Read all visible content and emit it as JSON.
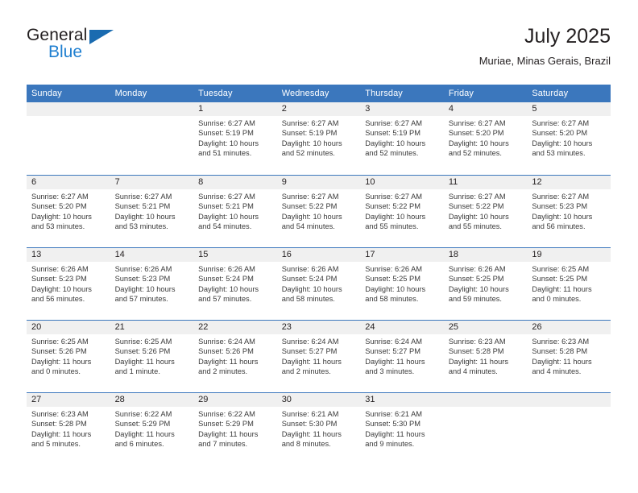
{
  "brand": {
    "name_top": "General",
    "name_bottom": "Blue",
    "accent_dark": "#1a6bb0",
    "accent_blue": "#1f7fd0"
  },
  "header": {
    "title": "July 2025",
    "subtitle": "Muriae, Minas Gerais, Brazil"
  },
  "calendar": {
    "header_color": "#3b77bd",
    "weekday_headers": [
      "Sunday",
      "Monday",
      "Tuesday",
      "Wednesday",
      "Thursday",
      "Friday",
      "Saturday"
    ],
    "weeks": [
      [
        {
          "day": "",
          "sunrise": "",
          "sunset": "",
          "daylight": "",
          "empty": true
        },
        {
          "day": "",
          "sunrise": "",
          "sunset": "",
          "daylight": "",
          "empty": true
        },
        {
          "day": "1",
          "sunrise": "Sunrise: 6:27 AM",
          "sunset": "Sunset: 5:19 PM",
          "daylight": "Daylight: 10 hours and 51 minutes."
        },
        {
          "day": "2",
          "sunrise": "Sunrise: 6:27 AM",
          "sunset": "Sunset: 5:19 PM",
          "daylight": "Daylight: 10 hours and 52 minutes."
        },
        {
          "day": "3",
          "sunrise": "Sunrise: 6:27 AM",
          "sunset": "Sunset: 5:19 PM",
          "daylight": "Daylight: 10 hours and 52 minutes."
        },
        {
          "day": "4",
          "sunrise": "Sunrise: 6:27 AM",
          "sunset": "Sunset: 5:20 PM",
          "daylight": "Daylight: 10 hours and 52 minutes."
        },
        {
          "day": "5",
          "sunrise": "Sunrise: 6:27 AM",
          "sunset": "Sunset: 5:20 PM",
          "daylight": "Daylight: 10 hours and 53 minutes."
        }
      ],
      [
        {
          "day": "6",
          "sunrise": "Sunrise: 6:27 AM",
          "sunset": "Sunset: 5:20 PM",
          "daylight": "Daylight: 10 hours and 53 minutes."
        },
        {
          "day": "7",
          "sunrise": "Sunrise: 6:27 AM",
          "sunset": "Sunset: 5:21 PM",
          "daylight": "Daylight: 10 hours and 53 minutes."
        },
        {
          "day": "8",
          "sunrise": "Sunrise: 6:27 AM",
          "sunset": "Sunset: 5:21 PM",
          "daylight": "Daylight: 10 hours and 54 minutes."
        },
        {
          "day": "9",
          "sunrise": "Sunrise: 6:27 AM",
          "sunset": "Sunset: 5:22 PM",
          "daylight": "Daylight: 10 hours and 54 minutes."
        },
        {
          "day": "10",
          "sunrise": "Sunrise: 6:27 AM",
          "sunset": "Sunset: 5:22 PM",
          "daylight": "Daylight: 10 hours and 55 minutes."
        },
        {
          "day": "11",
          "sunrise": "Sunrise: 6:27 AM",
          "sunset": "Sunset: 5:22 PM",
          "daylight": "Daylight: 10 hours and 55 minutes."
        },
        {
          "day": "12",
          "sunrise": "Sunrise: 6:27 AM",
          "sunset": "Sunset: 5:23 PM",
          "daylight": "Daylight: 10 hours and 56 minutes."
        }
      ],
      [
        {
          "day": "13",
          "sunrise": "Sunrise: 6:26 AM",
          "sunset": "Sunset: 5:23 PM",
          "daylight": "Daylight: 10 hours and 56 minutes."
        },
        {
          "day": "14",
          "sunrise": "Sunrise: 6:26 AM",
          "sunset": "Sunset: 5:23 PM",
          "daylight": "Daylight: 10 hours and 57 minutes."
        },
        {
          "day": "15",
          "sunrise": "Sunrise: 6:26 AM",
          "sunset": "Sunset: 5:24 PM",
          "daylight": "Daylight: 10 hours and 57 minutes."
        },
        {
          "day": "16",
          "sunrise": "Sunrise: 6:26 AM",
          "sunset": "Sunset: 5:24 PM",
          "daylight": "Daylight: 10 hours and 58 minutes."
        },
        {
          "day": "17",
          "sunrise": "Sunrise: 6:26 AM",
          "sunset": "Sunset: 5:25 PM",
          "daylight": "Daylight: 10 hours and 58 minutes."
        },
        {
          "day": "18",
          "sunrise": "Sunrise: 6:26 AM",
          "sunset": "Sunset: 5:25 PM",
          "daylight": "Daylight: 10 hours and 59 minutes."
        },
        {
          "day": "19",
          "sunrise": "Sunrise: 6:25 AM",
          "sunset": "Sunset: 5:25 PM",
          "daylight": "Daylight: 11 hours and 0 minutes."
        }
      ],
      [
        {
          "day": "20",
          "sunrise": "Sunrise: 6:25 AM",
          "sunset": "Sunset: 5:26 PM",
          "daylight": "Daylight: 11 hours and 0 minutes."
        },
        {
          "day": "21",
          "sunrise": "Sunrise: 6:25 AM",
          "sunset": "Sunset: 5:26 PM",
          "daylight": "Daylight: 11 hours and 1 minute."
        },
        {
          "day": "22",
          "sunrise": "Sunrise: 6:24 AM",
          "sunset": "Sunset: 5:26 PM",
          "daylight": "Daylight: 11 hours and 2 minutes."
        },
        {
          "day": "23",
          "sunrise": "Sunrise: 6:24 AM",
          "sunset": "Sunset: 5:27 PM",
          "daylight": "Daylight: 11 hours and 2 minutes."
        },
        {
          "day": "24",
          "sunrise": "Sunrise: 6:24 AM",
          "sunset": "Sunset: 5:27 PM",
          "daylight": "Daylight: 11 hours and 3 minutes."
        },
        {
          "day": "25",
          "sunrise": "Sunrise: 6:23 AM",
          "sunset": "Sunset: 5:28 PM",
          "daylight": "Daylight: 11 hours and 4 minutes."
        },
        {
          "day": "26",
          "sunrise": "Sunrise: 6:23 AM",
          "sunset": "Sunset: 5:28 PM",
          "daylight": "Daylight: 11 hours and 4 minutes."
        }
      ],
      [
        {
          "day": "27",
          "sunrise": "Sunrise: 6:23 AM",
          "sunset": "Sunset: 5:28 PM",
          "daylight": "Daylight: 11 hours and 5 minutes."
        },
        {
          "day": "28",
          "sunrise": "Sunrise: 6:22 AM",
          "sunset": "Sunset: 5:29 PM",
          "daylight": "Daylight: 11 hours and 6 minutes."
        },
        {
          "day": "29",
          "sunrise": "Sunrise: 6:22 AM",
          "sunset": "Sunset: 5:29 PM",
          "daylight": "Daylight: 11 hours and 7 minutes."
        },
        {
          "day": "30",
          "sunrise": "Sunrise: 6:21 AM",
          "sunset": "Sunset: 5:30 PM",
          "daylight": "Daylight: 11 hours and 8 minutes."
        },
        {
          "day": "31",
          "sunrise": "Sunrise: 6:21 AM",
          "sunset": "Sunset: 5:30 PM",
          "daylight": "Daylight: 11 hours and 9 minutes."
        },
        {
          "day": "",
          "sunrise": "",
          "sunset": "",
          "daylight": "",
          "empty": true
        },
        {
          "day": "",
          "sunrise": "",
          "sunset": "",
          "daylight": "",
          "empty": true
        }
      ]
    ]
  }
}
